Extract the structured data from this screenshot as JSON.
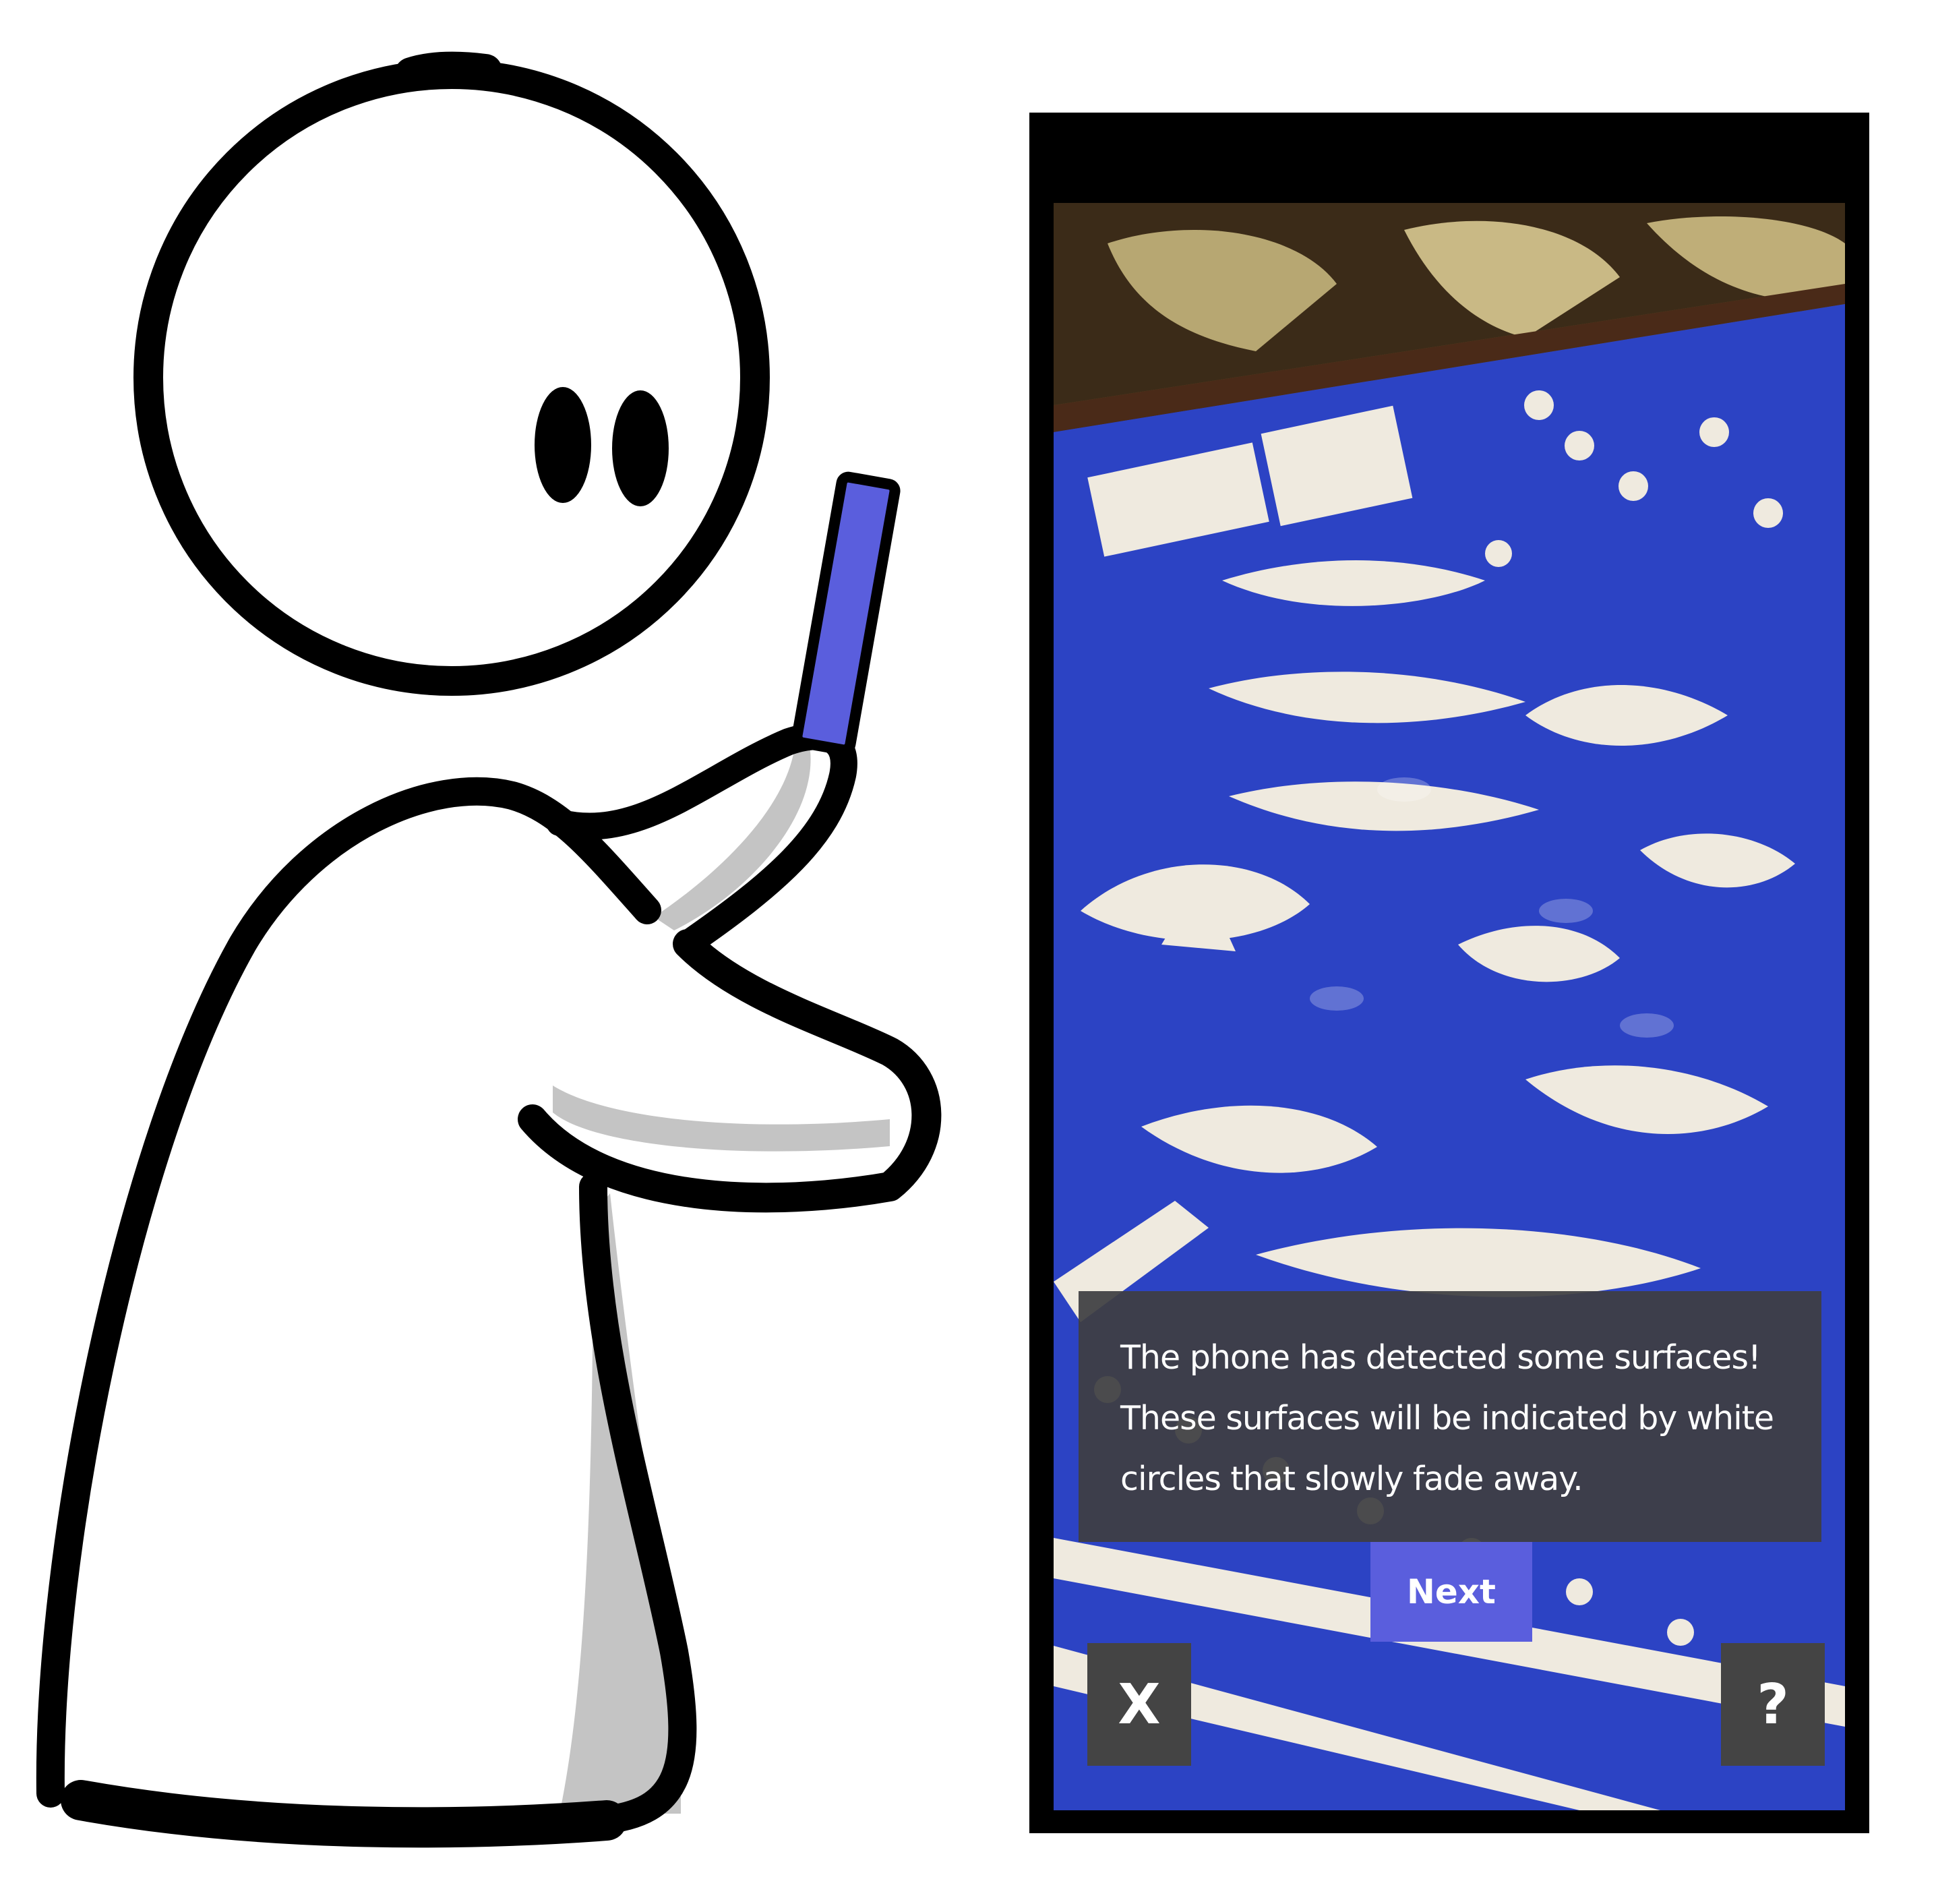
{
  "overlay": {
    "message": "The phone has detected some surfaces! These surfaces will be indicated by white circles that slowly fade away.",
    "next_label": "Next",
    "close_label": "X",
    "help_label": "?"
  },
  "colors": {
    "accent": "#5a5edd",
    "overlay_background": "#3e3e42",
    "carpet_blue": "#2c43c4",
    "shadow_gray": "#c4c4c4"
  }
}
